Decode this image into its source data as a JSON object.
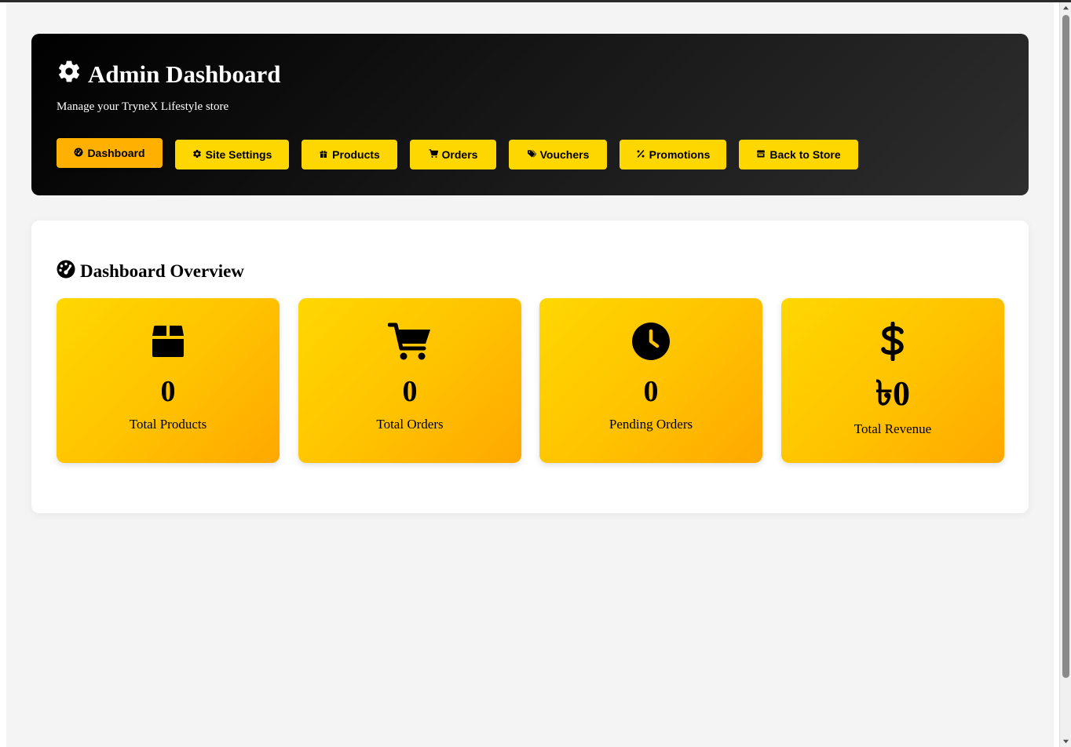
{
  "header": {
    "title": "Admin Dashboard",
    "subtitle": "Manage your TryneX Lifestyle store",
    "icon": "gear-icon"
  },
  "nav": {
    "items": [
      {
        "label": "Dashboard",
        "icon": "gauge-icon",
        "active": true
      },
      {
        "label": "Site Settings",
        "icon": "gear-icon",
        "active": false
      },
      {
        "label": "Products",
        "icon": "gift-icon",
        "active": false
      },
      {
        "label": "Orders",
        "icon": "cart-icon",
        "active": false
      },
      {
        "label": "Vouchers",
        "icon": "tags-icon",
        "active": false
      },
      {
        "label": "Promotions",
        "icon": "percent-icon",
        "active": false
      },
      {
        "label": "Back to Store",
        "icon": "store-icon",
        "active": false
      }
    ]
  },
  "overview": {
    "title": "Dashboard Overview",
    "icon": "gauge-icon",
    "cards": [
      {
        "value": "0",
        "label": "Total Products",
        "icon": "box-icon"
      },
      {
        "value": "0",
        "label": "Total Orders",
        "icon": "cart-icon"
      },
      {
        "value": "0",
        "label": "Pending Orders",
        "icon": "clock-icon"
      },
      {
        "value": "৳0",
        "label": "Total Revenue",
        "icon": "dollar-icon"
      }
    ]
  },
  "colors": {
    "accent": "#ffd700",
    "accent_active": "#ffb000",
    "header_dark": "#000000",
    "page_bg": "#f4f4f4"
  }
}
